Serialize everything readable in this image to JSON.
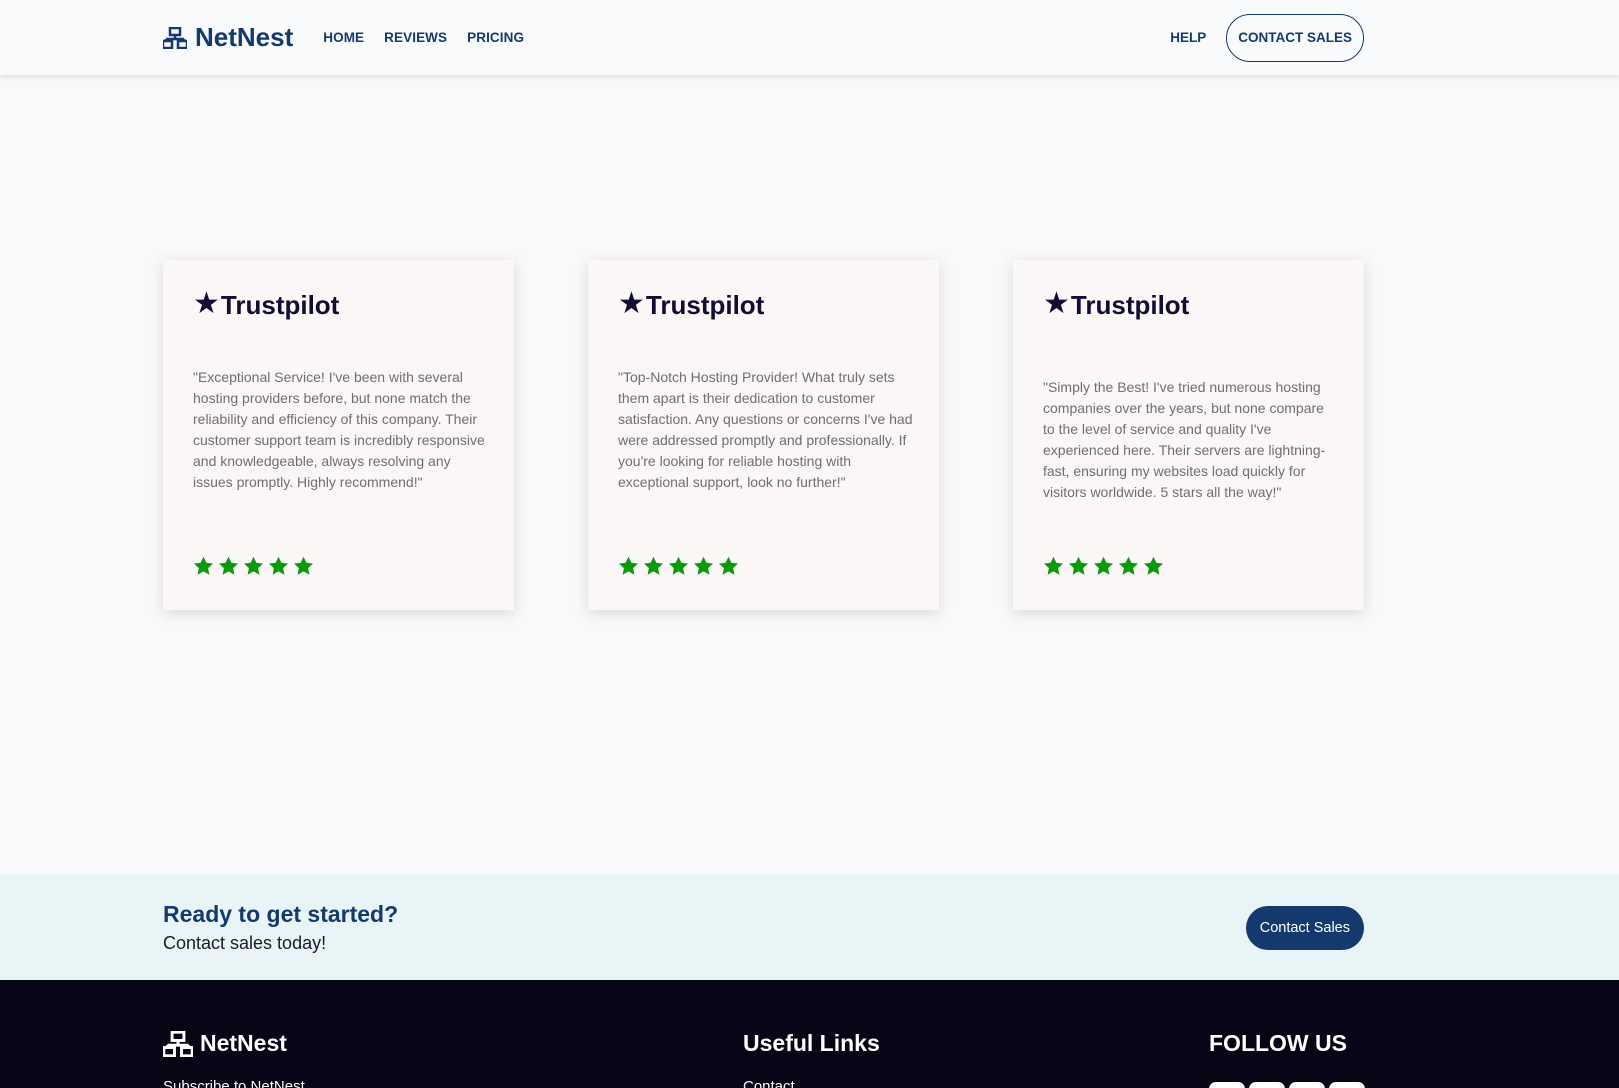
{
  "header": {
    "brand": "NetNest",
    "nav": [
      "HOME",
      "REVIEWS",
      "PRICING"
    ],
    "help": "HELP",
    "contact_sales": "CONTACT SALES"
  },
  "reviews": [
    {
      "source": "Trustpilot",
      "quote": "\"Exceptional Service! I've been with several hosting providers before, but none match the reliability and efficiency of this company. Their customer support team is incredibly responsive and knowledgeable, always resolving any issues promptly. Highly recommend!\"",
      "rating": 5
    },
    {
      "source": "Trustpilot",
      "quote": "\"Top-Notch Hosting Provider! What truly sets them apart is their dedication to customer satisfaction. Any questions or concerns I've had were addressed promptly and professionally. If you're looking for reliable hosting with exceptional support, look no further!\"",
      "rating": 5
    },
    {
      "source": "Trustpilot",
      "quote": "\"Simply the Best! I've tried numerous hosting companies over the years, but none compare to the level of service and quality I've experienced here. Their servers are lightning-fast, ensuring my websites load quickly for visitors worldwide. 5 stars all the way!\"",
      "rating": 5
    }
  ],
  "cta": {
    "title": "Ready to get started?",
    "subtitle": "Contact sales today!",
    "button": "Contact Sales"
  },
  "footer": {
    "brand": "NetNest",
    "subscribe": "Subscribe to NetNest",
    "links_title": "Useful Links",
    "link_contact": "Contact",
    "follow_title": "FOLLOW US"
  },
  "colors": {
    "brand_navy": "#143a6d",
    "star_green": "#0a9a0a",
    "footer_bg": "#070617",
    "cta_bg": "#e8f4f6"
  },
  "icons": {
    "logo": "network-icon",
    "rating": "star-icon",
    "trustpilot": "star-icon"
  }
}
